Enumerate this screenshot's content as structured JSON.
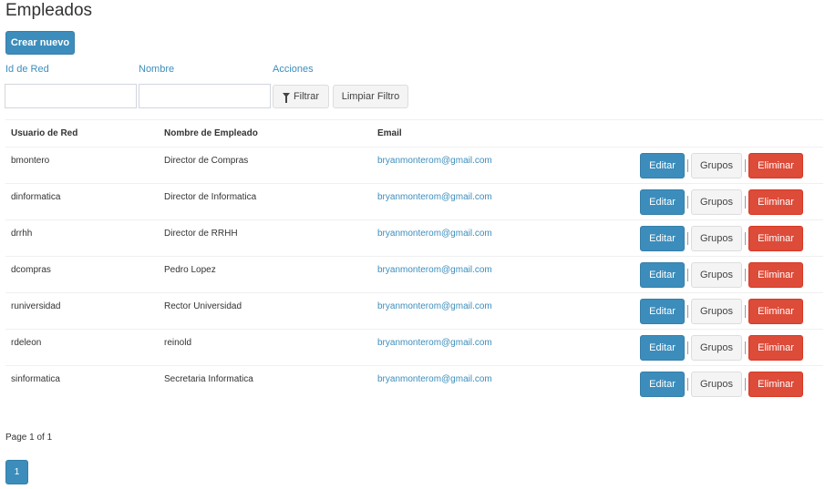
{
  "page": {
    "title": "Empleados",
    "create_label": "Crear nuevo"
  },
  "filters": {
    "labels": [
      "Id de Red",
      "Nombre",
      "Acciones"
    ],
    "id_value": "",
    "name_value": "",
    "filter_label": "Filtrar",
    "clear_label": "Limpiar Filtro",
    "filter_icon": "funnel-icon"
  },
  "table": {
    "headers": [
      "Usuario de Red",
      "Nombre de Empleado",
      "Email",
      ""
    ],
    "rows": [
      [
        "bmontero",
        "Director de Compras",
        "bryanmonterom@gmail.com"
      ],
      [
        "dinformatica",
        "Director de Informatica",
        "bryanmonterom@gmail.com"
      ],
      [
        "drrhh",
        "Director de RRHH",
        "bryanmonterom@gmail.com"
      ],
      [
        "dcompras",
        "Pedro Lopez",
        "bryanmonterom@gmail.com"
      ],
      [
        "runiversidad",
        "Rector Universidad",
        "bryanmonterom@gmail.com"
      ],
      [
        "rdeleon",
        "reinold",
        "bryanmonterom@gmail.com"
      ],
      [
        "sinformatica",
        "Secretaria Informatica",
        "bryanmonterom@gmail.com"
      ]
    ],
    "actions": {
      "edit": "Editar",
      "groups": "Grupos",
      "delete": "Eliminar",
      "separator": "|"
    }
  },
  "pagination": {
    "summary": "Page 1 of 1",
    "current": "1"
  },
  "colors": {
    "primary": "#3c8dbc",
    "danger": "#dd4b39",
    "default": "#f4f4f4"
  }
}
